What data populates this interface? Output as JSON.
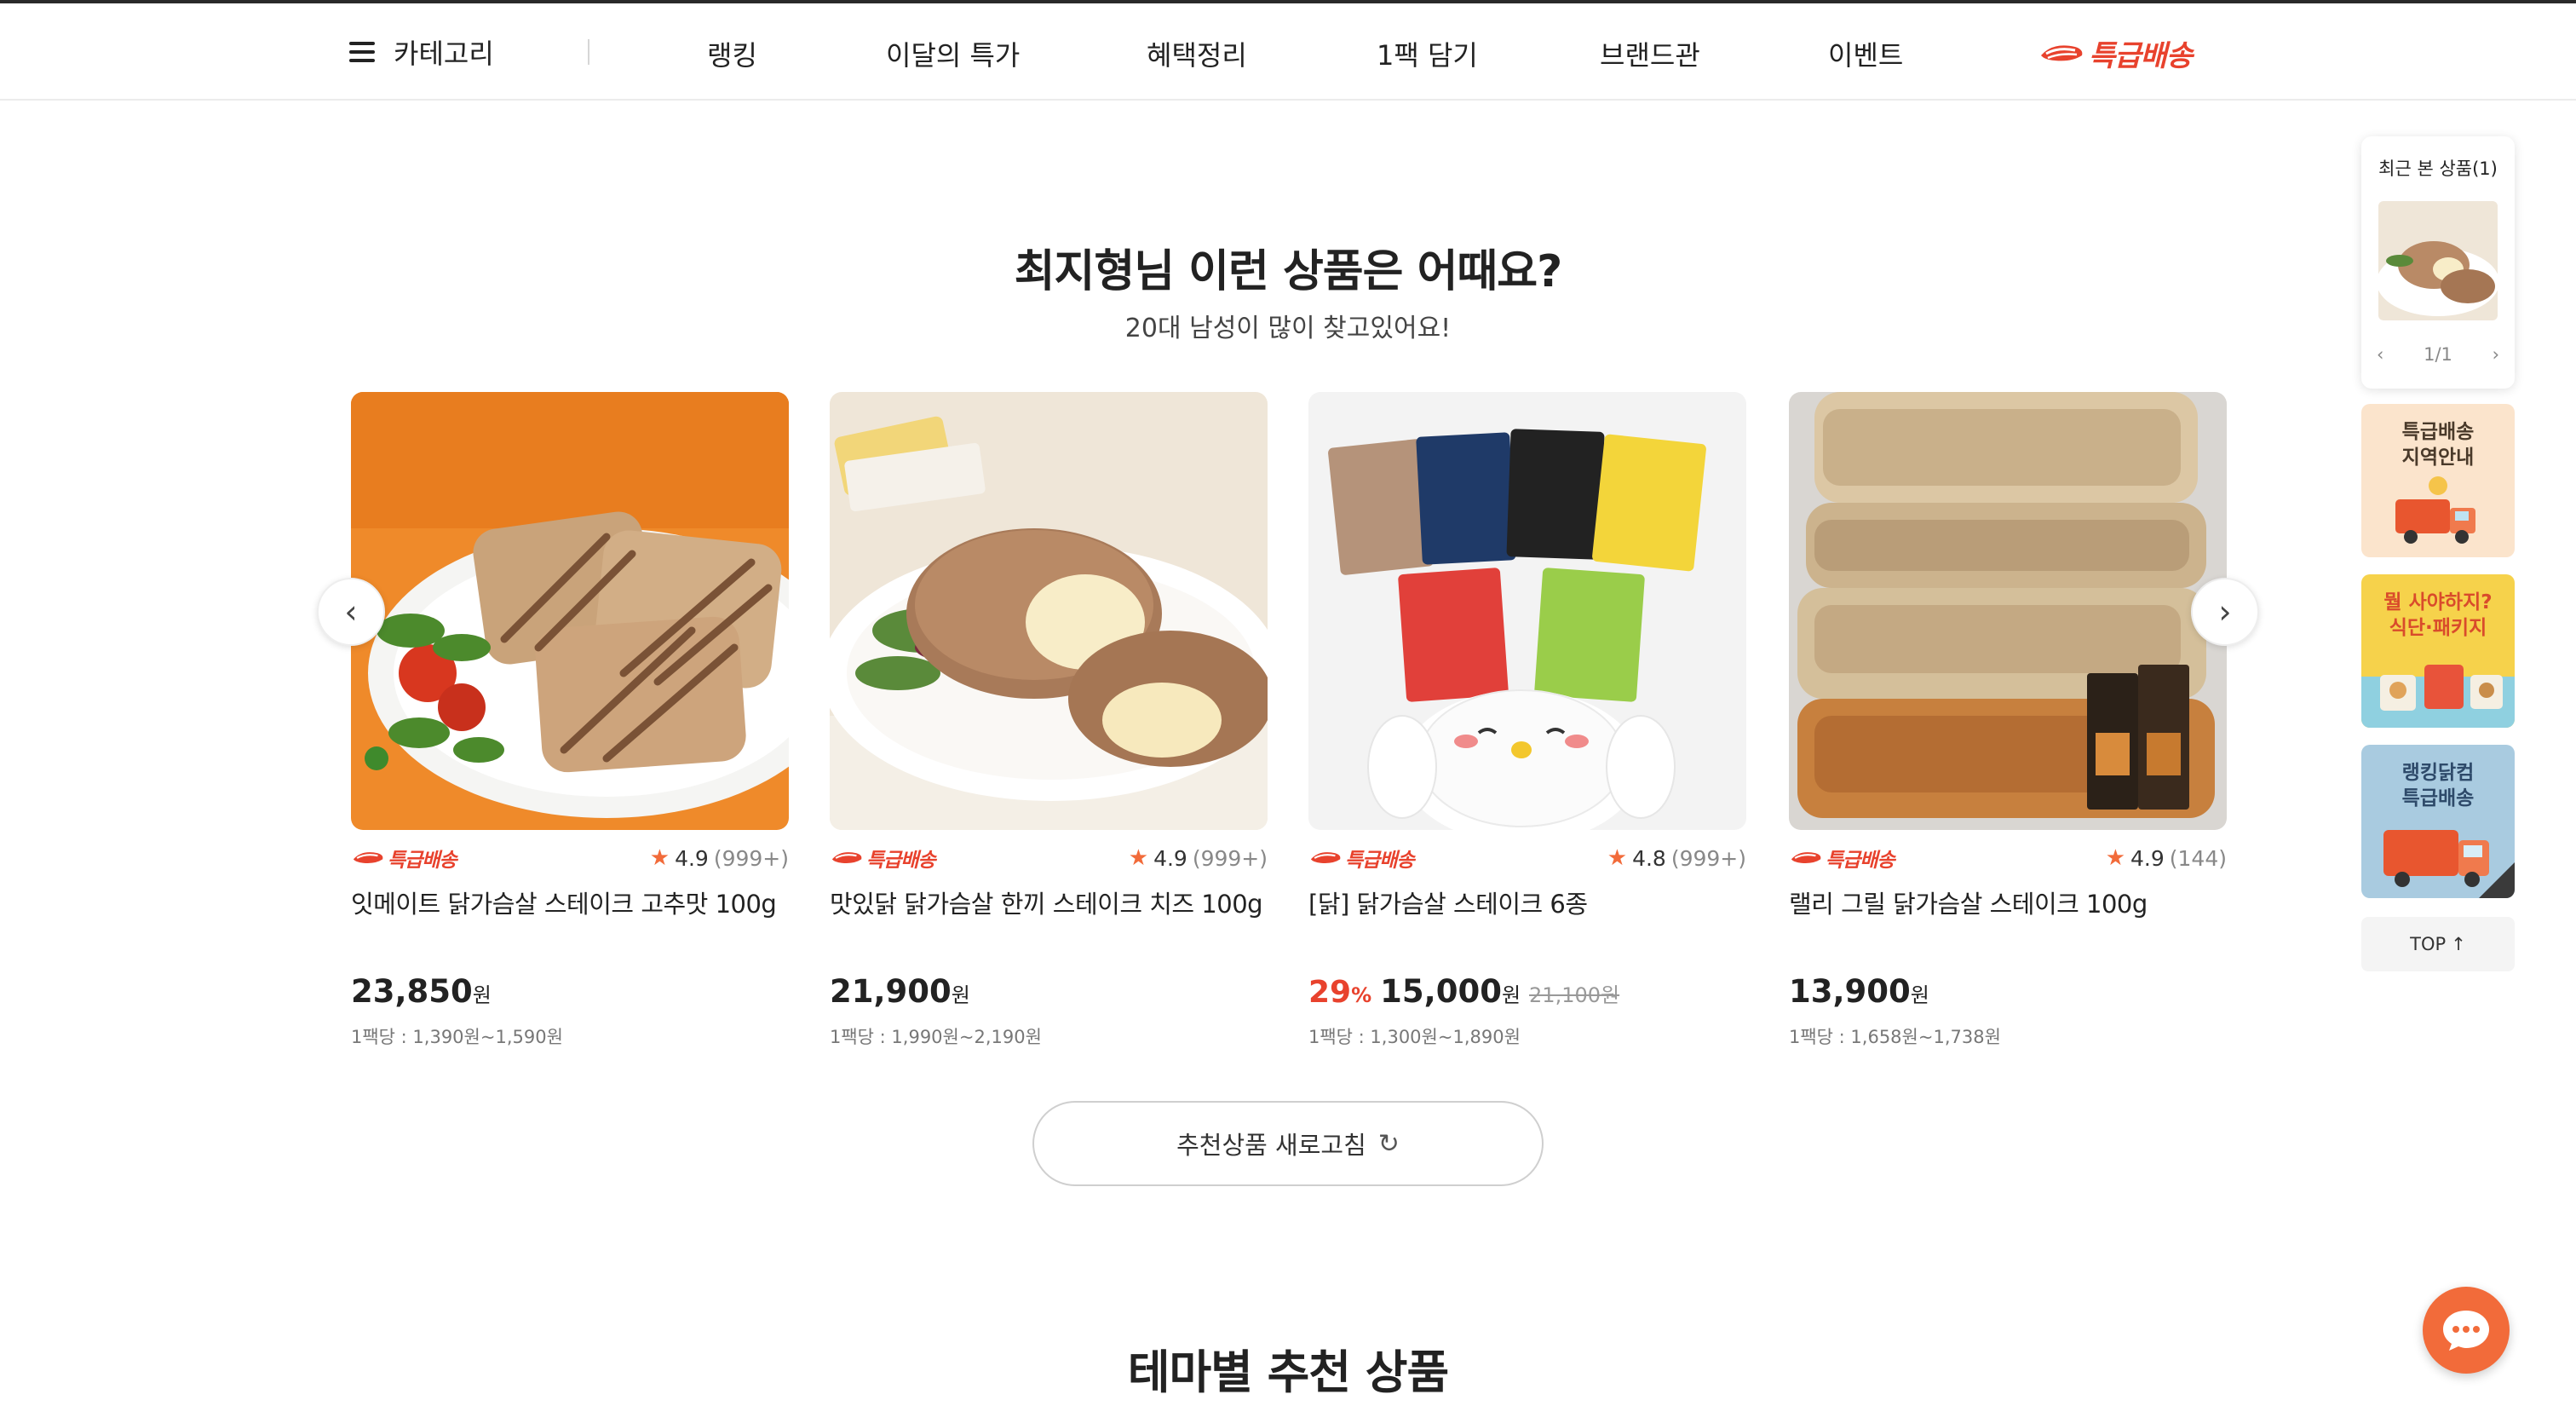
{
  "nav": {
    "category_label": "카테고리",
    "items": [
      "랭킹",
      "이달의 특가",
      "혜택정리",
      "1팩 담기",
      "브랜드관",
      "이벤트"
    ],
    "express_label": "특급배송"
  },
  "section": {
    "title": "최지형님 이런 상품은 어때요?",
    "subtitle": "20대 남성이 많이 찾고있어요!"
  },
  "products": [
    {
      "badge": "특급배송",
      "rating": "4.9",
      "review_count": "(999+)",
      "name": "잇메이트 닭가슴살 스테이크 고추맛 100g",
      "discount": "",
      "discount_unit": "",
      "price": "23,850",
      "price_unit": "원",
      "original_price": "",
      "per_pack": "1팩당 : 1,390원~1,590원"
    },
    {
      "badge": "특급배송",
      "rating": "4.9",
      "review_count": "(999+)",
      "name": "맛있닭 닭가슴살 한끼 스테이크 치즈 100g",
      "discount": "",
      "discount_unit": "",
      "price": "21,900",
      "price_unit": "원",
      "original_price": "",
      "per_pack": "1팩당 : 1,990원~2,190원"
    },
    {
      "badge": "특급배송",
      "rating": "4.8",
      "review_count": "(999+)",
      "name": "[닭] 닭가슴살 스테이크 6종",
      "discount": "29",
      "discount_unit": "%",
      "price": "15,000",
      "price_unit": "원",
      "original_price": "21,100원",
      "per_pack": "1팩당 : 1,300원~1,890원"
    },
    {
      "badge": "특급배송",
      "rating": "4.9",
      "review_count": "(144)",
      "name": "랠리 그릴 닭가슴살 스테이크 100g",
      "discount": "",
      "discount_unit": "",
      "price": "13,900",
      "price_unit": "원",
      "original_price": "",
      "per_pack": "1팩당 : 1,658원~1,738원"
    }
  ],
  "refresh_label": "추천상품 새로고침",
  "theme_title": "테마별 추천 상품",
  "sidebar": {
    "recent_title": "최근 본 상품(1)",
    "pager": "1/1",
    "banner1": "특급배송\n지역안내",
    "banner2": "뭘 사야하지?\n식단·패키지",
    "banner3": "랭킹닭컴\n특급배송",
    "top_label": "TOP"
  },
  "icons": {
    "menu": "hamburger-icon",
    "star": "star-icon",
    "prev": "chevron-left-icon",
    "next": "chevron-right-icon",
    "refresh": "refresh-icon",
    "chat": "chat-bubble-icon",
    "up": "arrow-up-icon"
  },
  "colors": {
    "accent": "#e8422d",
    "star": "#f26b3a",
    "chat": "#f26b3a"
  }
}
